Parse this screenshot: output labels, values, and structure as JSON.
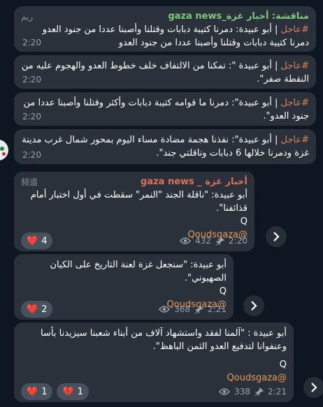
{
  "forwarded_header": {
    "title": "مناقشة: أخبار غزة_gaza news",
    "sender": "ريم"
  },
  "messages": [
    {
      "hashtag": "#عاجل",
      "text": " | أبو عبيدة: دمرنا كتيبة دبابات وقتلنا وأصبنا عددا من جنود العدو دمرنا كتيبة دبابات وقتلنا وأصبنا عددا من جنود العدو",
      "time": "2:20"
    },
    {
      "hashtag": "#عاجل",
      "text": " | أبو عبيدة \": تمكنا من الالتفاف خلف خطوط العدو والهجوم عليه من النقطة صفر\".",
      "time": "2:20"
    },
    {
      "hashtag": "#عاجل",
      "text": " | أبو عبيدة\": دمرنا ما قوامه كتيبة دبابات وأكثر وقتلنا وأصبنا عددا من جنود العدو\".",
      "time": "2:20"
    },
    {
      "hashtag": "#عاجل",
      "text": " | أبو عبيدة\": نفذنا هجمة مضادة مساء اليوم بمحور شمال غرب مدينة غزة ودمرنا خلالها 6 دبابات وناقلتي جند\".",
      "time": "2:20"
    }
  ],
  "channel_posts": [
    {
      "channel": "أخبار غزة _ gaza news",
      "tag": "频道",
      "text": "أبو عبيدة: \"ناقلة الجند \"النمر\" سقطت في أول اختبار أمام قذائفنا\".",
      "q": "Q",
      "mention": "@Qoudsgaza",
      "reactions": [
        {
          "emoji": "❤️",
          "count": "4"
        }
      ],
      "views": "432",
      "time": "2:20"
    },
    {
      "text": "أبو عبيدة: \"سنجعل غزة لعنة التاريخ على الكيان الصهيوني\".",
      "q": "Q",
      "mention": "@Qoudsgaza",
      "reactions": [
        {
          "emoji": "❤️",
          "count": "2"
        }
      ],
      "views": "368",
      "time": "2:21"
    },
    {
      "text": "أبو عبيدة : \"آلمنا لفقد واستشهاد آلاف من أبناء شعبنا سيزيدنا بأسا وعنفوانا لتدفيع العدو الثمن الباهظ\".",
      "q": "Q",
      "mention": "@Qoudsgaza",
      "reactions": [
        {
          "emoji": "❤️",
          "count": "1"
        },
        {
          "emoji": "💔",
          "count": "1"
        }
      ],
      "views": "338",
      "time": "2:21"
    }
  ],
  "icons": {
    "views": "eye-icon",
    "forwarded": "pin-icon",
    "share": "chevron-right-icon"
  },
  "colors": {
    "background": "#0e1621",
    "bubble": "#2b313a",
    "hashtag": "#d97f5e",
    "mention": "#e89a5e",
    "channel_name": "#e07058",
    "header_title": "#7fc97f"
  }
}
